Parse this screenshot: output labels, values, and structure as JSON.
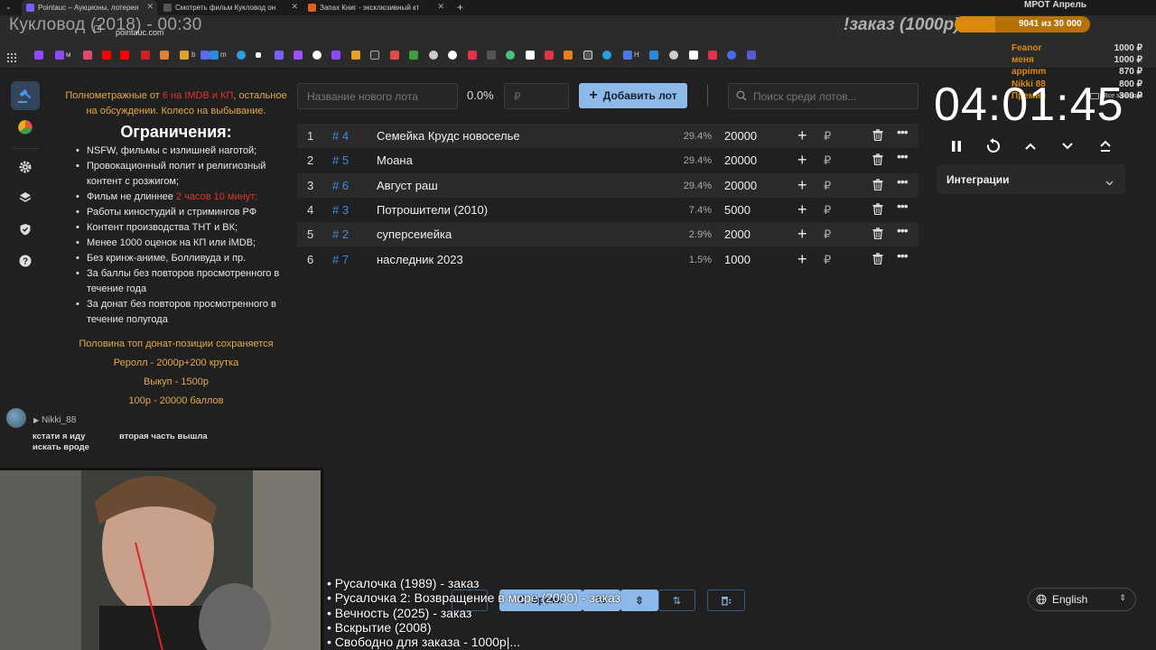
{
  "browser": {
    "tabs": [
      {
        "title": "Pointauc – Аукционы, лотереи",
        "active": true,
        "color": "#7a5cff"
      },
      {
        "title": "Смотреть фильм Кукловод он",
        "active": false,
        "color": "#555555"
      },
      {
        "title": "Запах Книг - эксклюзивный кт",
        "active": false,
        "color": "#e06020"
      }
    ],
    "new_tab_label": "+",
    "url": "pointauc.com",
    "bookmark_labels": [
      "м",
      "b",
      "m",
      "H"
    ],
    "all_bookmarks": "Все закладки"
  },
  "stream": {
    "title": "Кукловод (2018) - 00:30",
    "order_text": "!заказ (1000р)",
    "goal_title": "МРОТ Апрель",
    "goal_progress": "9041  из 30 000",
    "goal_fraction": 0.3,
    "donors": [
      {
        "name": "Feanor",
        "amount": "1000 ₽"
      },
      {
        "name": "меня",
        "amount": "1000 ₽"
      },
      {
        "name": "appimm",
        "amount": "870 ₽"
      },
      {
        "name": "Nikki 88",
        "amount": "800 ₽"
      },
      {
        "name": "Премия",
        "amount": "300 ₽"
      }
    ],
    "overlay_list": [
      "• Русалочка (1989) - заказ",
      "• Русалочка 2: Возвращение в море (2000) - заказ",
      "• Вечность (2025) - заказ",
      "• Вскрытие (2008)",
      "• Свободно для заказа - 1000р|..."
    ]
  },
  "rules": {
    "intro_a": "Полнометражные от ",
    "intro_red": "6 на IMDB и КП",
    "intro_b": ", остальное на обсуждении. Колесо на выбывание.",
    "title": "Ограничения:",
    "items": [
      "NSFW, фильмы с излишней наготой;",
      "Провокационный полит и религиозный контент с розжигом;",
      "Фильм не длиннее ",
      "Работы киностудий и стримингов РФ",
      "Контент производства ТНТ и ВК;",
      "Менее 1000 оценок на КП или iMDB;",
      "Без кринж-аниме, Болливуда и пр.",
      "За баллы без повторов просмотренного в течение года",
      "За донат без повторов просмотренного в течение полугода"
    ],
    "duration_red": "2 часов 10 минут;",
    "footer": [
      "Половина топ донат-позиции сохраняется",
      "Реролл - 2000р+200 крутка",
      "Выкуп - 1500р",
      "100р - 20000 баллов"
    ]
  },
  "lot_form": {
    "name_placeholder": "Название нового лота",
    "percent": "0.0%",
    "amount_placeholder": "₽",
    "add_label": "Добавить лот",
    "search_placeholder": "Поиск среди лотов..."
  },
  "lots": [
    {
      "num": "1",
      "id": "# 4",
      "name": "Семейка Крудс новоселье",
      "percent": "29.4%",
      "amount": "20000"
    },
    {
      "num": "2",
      "id": "# 5",
      "name": "Моана",
      "percent": "29.4%",
      "amount": "20000"
    },
    {
      "num": "3",
      "id": "# 6",
      "name": "Август раш",
      "percent": "29.4%",
      "amount": "20000"
    },
    {
      "num": "4",
      "id": "# 3",
      "name": "Потрошители (2010)",
      "percent": "7.4%",
      "amount": "5000"
    },
    {
      "num": "5",
      "id": "# 2",
      "name": "суперсеиейка",
      "percent": "2.9%",
      "amount": "2000"
    },
    {
      "num": "6",
      "id": "# 7",
      "name": "наследник 2023",
      "percent": "1.5%",
      "amount": "1000"
    }
  ],
  "lot_row_labels": {
    "currency": "₽",
    "more": "•••"
  },
  "timer": {
    "value": "04:01:45"
  },
  "integrations": {
    "label": "Интеграции"
  },
  "chat": {
    "user": "Nikki_88",
    "message_a": "кстати я иду искать вроде",
    "message_b": "вторая часть вышла"
  },
  "bottom_toolbar": {
    "mode_label": "Время",
    "percent_label": "%",
    "language": "English"
  },
  "colors": {
    "accent": "#8db8ea",
    "lot_id": "#3b8de0",
    "rules_orange": "#e4a94a",
    "rules_red": "#e23232",
    "donor_orange": "#d88a08"
  }
}
